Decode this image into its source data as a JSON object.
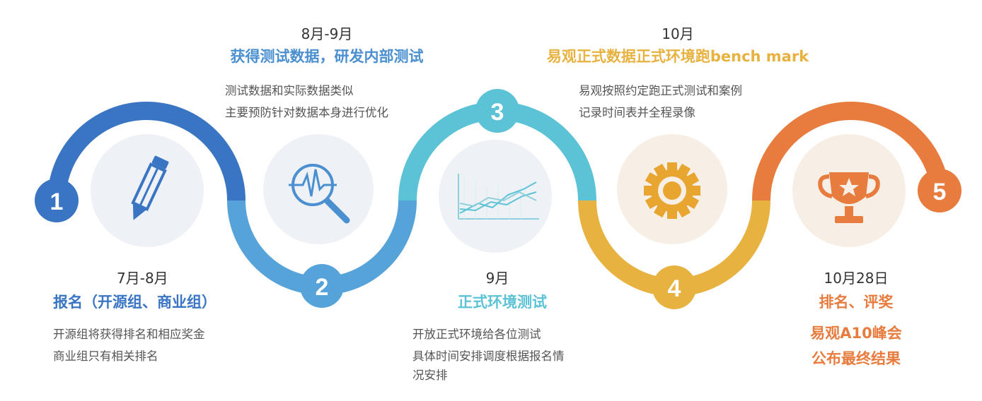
{
  "colors": {
    "stage1": "#3a75c4",
    "stage2": "#56a3d9",
    "stage3": "#5cc3d6",
    "stage4": "#e8b241",
    "stage5": "#e87b3e",
    "icon_bg": "#eef1f5",
    "icon_bg_warm": "#f7efe6"
  },
  "stages": [
    {
      "number": "1",
      "date": "7月-8月",
      "title": "报名（开源组、商业组）",
      "lines": [
        "开源组将获得排名和相应奖金",
        "商业组只有相关排名"
      ],
      "icon": "pencil-icon"
    },
    {
      "number": "2",
      "date": "8月-9月",
      "title": "获得测试数据，研发内部测试",
      "lines": [
        "测试数据和实际数据类似",
        "主要预防针对数据本身进行优化"
      ],
      "icon": "magnifier-pulse-icon"
    },
    {
      "number": "3",
      "date": "9月",
      "title": "正式环境测试",
      "lines": [
        "开放正式环境给各位测试",
        "具体时间安排调度根据报名情",
        "况安排"
      ],
      "icon": "line-chart-icon"
    },
    {
      "number": "4",
      "date": "10月",
      "title": "易观正式数据正式环境跑bench mark",
      "lines": [
        "易观按照约定跑正式测试和案例",
        "记录时间表并全程录像"
      ],
      "icon": "gear-icon"
    },
    {
      "number": "5",
      "date": "10月28日",
      "title": "排名、评奖",
      "lines": [
        "易观A10峰会",
        "公布最终结果"
      ],
      "icon": "trophy-icon"
    }
  ]
}
